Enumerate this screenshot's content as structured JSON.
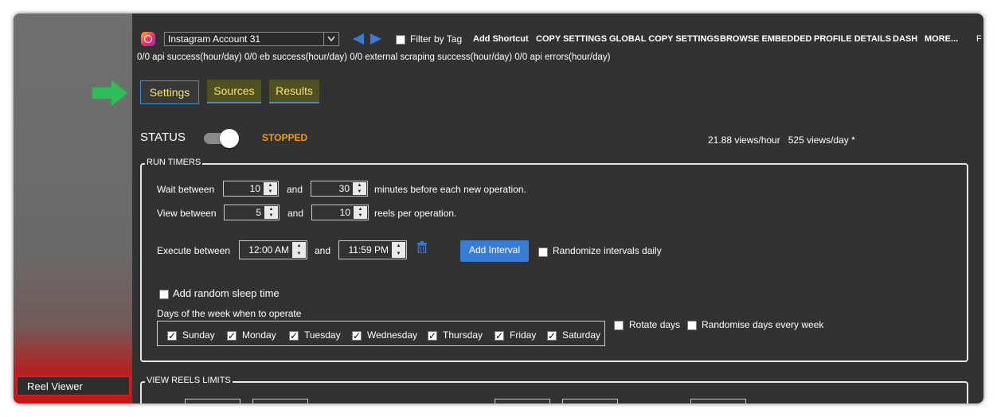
{
  "account": {
    "selected": "Instagram Account 31"
  },
  "toolbar": {
    "filter_by_tag": "Filter by Tag",
    "links": [
      "Add Shortcut",
      "COPY SETTINGS",
      "GLOBAL COPY SETTINGS",
      "BROWSE EMBEDDED",
      "PROFILE DETAILS",
      "DASH",
      "MORE..."
    ],
    "clipped_text": "F"
  },
  "stats_line": "0/0 api success(hour/day) 0/0 eb success(hour/day) 0/0 external scraping success(hour/day) 0/0 api errors(hour/day)",
  "tabs": [
    "Settings",
    "Sources",
    "Results"
  ],
  "status": {
    "label": "STATUS",
    "state": "STOPPED",
    "rate": "21.88 views/hour   525 views/day *"
  },
  "run_timers": {
    "title": "RUN TIMERS",
    "wait_label": "Wait between",
    "wait_min": "10",
    "wait_and": "and",
    "wait_max": "30",
    "wait_suffix": "minutes before each new operation.",
    "view_label": "View between",
    "view_min": "5",
    "view_and": "and",
    "view_max": "10",
    "view_suffix": "reels per operation.",
    "exec_label": "Execute between",
    "exec_start": "12:00 AM",
    "exec_and": "and",
    "exec_end": "11:59 PM",
    "add_interval": "Add Interval",
    "randomize_intervals": "Randomize intervals daily",
    "random_sleep": "Add random sleep time",
    "days_title": "Days of the week when to operate",
    "days": [
      "Sunday",
      "Monday",
      "Tuesday",
      "Wednesday",
      "Thursday",
      "Friday",
      "Saturday"
    ],
    "rotate_days": "Rotate days",
    "randomise_days": "Randomise days every week"
  },
  "view_reels_limits": {
    "title": "VIEW REELS LIMITS"
  },
  "sidebar": {
    "current": "Reel Viewer"
  },
  "colors": {
    "accent_blue": "#3a7bd5",
    "status_orange": "#f39a1e",
    "green_arrow": "#2ebd59",
    "highlight_red": "#e01a1a"
  }
}
